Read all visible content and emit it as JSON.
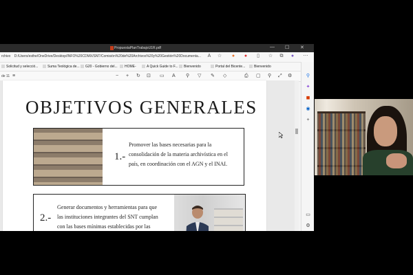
{
  "browser": {
    "tab_title": "PropuestaPlanTrabajoU1R.pdf",
    "address_prefix": "rchivo",
    "url": "D:/Users/esthe/OneDrive/Desktop/INFO%20CDMX/SNT/Comisión%20de%20Archivos%20y%20Gestión%20Documenta..."
  },
  "bookmarks": [
    {
      "label": "Solicitud y selecció..."
    },
    {
      "label": "Suma Teológica de..."
    },
    {
      "label": "G20 - Gobierno del..."
    },
    {
      "label": "HOME-"
    },
    {
      "label": "A Quick Guide to F..."
    },
    {
      "label": "Bienvenido"
    },
    {
      "label": "Portal del Bicente..."
    },
    {
      "label": "Bienvenido"
    }
  ],
  "pdf_toolbar": {
    "page_indicator": "de 11",
    "zoom_minus": "−",
    "zoom_plus": "+"
  },
  "document": {
    "heading": "OBJETIVOS GENERALES",
    "objectives": [
      {
        "number": "1.-",
        "lines": [
          "Promover las bases necesarias para la",
          "consolidación de la materia archivística en el",
          "país, en coordinación con el AGN y el INAI."
        ]
      },
      {
        "number": "2.-",
        "lines": [
          "Generar documentos y herramientas para que",
          "las instituciones integrantes del SNT cumplan",
          "con las bases mínimas establecidas por las"
        ]
      }
    ]
  },
  "icons": {
    "sidebar": [
      "search-icon",
      "sparkle-icon",
      "office-icon",
      "outlook-icon",
      "add-icon",
      "panel-icon",
      "settings-icon"
    ]
  }
}
